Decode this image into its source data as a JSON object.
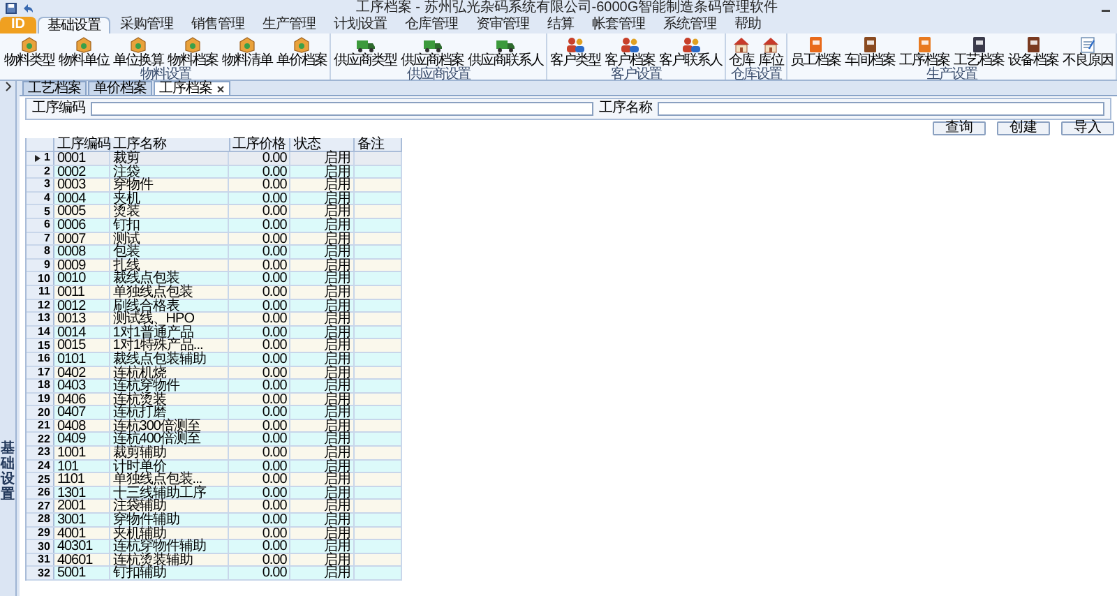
{
  "title_bar": {
    "title": "工序档案 - 苏州弘光杂码系统有限公司-6000G智能制造条码管理软件"
  },
  "menu": {
    "app_button": "ID",
    "tabs": [
      {
        "label": "基础设置",
        "selected": true
      },
      {
        "label": "采购管理",
        "selected": false
      },
      {
        "label": "销售管理",
        "selected": false
      },
      {
        "label": "生产管理",
        "selected": false
      },
      {
        "label": "计划设置",
        "selected": false
      },
      {
        "label": "仓库管理",
        "selected": false
      },
      {
        "label": "资审管理",
        "selected": false
      },
      {
        "label": "结算",
        "selected": false
      },
      {
        "label": "帐套管理",
        "selected": false
      },
      {
        "label": "系统管理",
        "selected": false
      },
      {
        "label": "帮助",
        "selected": false
      }
    ]
  },
  "ribbon": {
    "groups": [
      {
        "label": "物料设置",
        "items": [
          "物料类型",
          "物料单位",
          "单位换算",
          "物料档案",
          "物料清单",
          "单价档案"
        ]
      },
      {
        "label": "供应商设置",
        "items": [
          "供应商类型",
          "供应商档案",
          "供应商联系人"
        ]
      },
      {
        "label": "客户设置",
        "items": [
          "客户类型",
          "客户档案",
          "客户联系人"
        ]
      },
      {
        "label": "仓库设置",
        "items": [
          "仓库",
          "库位"
        ]
      },
      {
        "label": "生产设置",
        "items": [
          "员工档案",
          "车间档案",
          "工序档案",
          "工艺档案",
          "设备档案",
          "不良原因"
        ]
      }
    ]
  },
  "sidebar": {
    "label": "基础设置"
  },
  "doc_tabs": [
    {
      "label": "工艺档案",
      "selected": false
    },
    {
      "label": "单价档案",
      "selected": false
    },
    {
      "label": "工序档案",
      "selected": true
    }
  ],
  "search": {
    "fields": [
      {
        "label": "工序编码"
      },
      {
        "label": "工序名称"
      }
    ]
  },
  "buttons": [
    "查询",
    "创建",
    "导入"
  ],
  "table": {
    "columns": [
      "工序编码",
      "工序名称",
      "工序价格",
      "状态",
      "备注"
    ],
    "rows": [
      {
        "number": "1",
        "cells": [
          "0001",
          "裁剪",
          "0.00",
          "启用",
          ""
        ],
        "selected": true
      },
      {
        "number": "2",
        "cells": [
          "0002",
          "注袋",
          "0.00",
          "启用",
          ""
        ],
        "selected": false
      },
      {
        "number": "3",
        "cells": [
          "0003",
          "穿物件",
          "0.00",
          "启用",
          ""
        ],
        "selected": false
      },
      {
        "number": "4",
        "cells": [
          "0004",
          "夹机",
          "0.00",
          "启用",
          ""
        ],
        "selected": false
      },
      {
        "number": "5",
        "cells": [
          "0005",
          "烫装",
          "0.00",
          "启用",
          ""
        ],
        "selected": false
      },
      {
        "number": "6",
        "cells": [
          "0006",
          "钉扣",
          "0.00",
          "启用",
          ""
        ],
        "selected": false
      },
      {
        "number": "7",
        "cells": [
          "0007",
          "测试",
          "0.00",
          "启用",
          ""
        ],
        "selected": false
      },
      {
        "number": "8",
        "cells": [
          "0008",
          "包装",
          "0.00",
          "启用",
          ""
        ],
        "selected": false
      },
      {
        "number": "9",
        "cells": [
          "0009",
          "扎线",
          "0.00",
          "启用",
          ""
        ],
        "selected": false
      },
      {
        "number": "10",
        "cells": [
          "0010",
          "裁线点包装",
          "0.00",
          "启用",
          ""
        ],
        "selected": false
      },
      {
        "number": "11",
        "cells": [
          "0011",
          "单独线点包装",
          "0.00",
          "启用",
          ""
        ],
        "selected": false
      },
      {
        "number": "12",
        "cells": [
          "0012",
          "刷线合格表",
          "0.00",
          "启用",
          ""
        ],
        "selected": false
      },
      {
        "number": "13",
        "cells": [
          "0013",
          "测试线、HPO",
          "0.00",
          "启用",
          ""
        ],
        "selected": false
      },
      {
        "number": "14",
        "cells": [
          "0014",
          "1对1普通产品",
          "0.00",
          "启用",
          ""
        ],
        "selected": false
      },
      {
        "number": "15",
        "cells": [
          "0015",
          "1对1特殊产品...",
          "0.00",
          "启用",
          ""
        ],
        "selected": false
      },
      {
        "number": "16",
        "cells": [
          "0101",
          "裁线点包装辅助",
          "0.00",
          "启用",
          ""
        ],
        "selected": false
      },
      {
        "number": "17",
        "cells": [
          "0402",
          "连杭机烧",
          "0.00",
          "启用",
          ""
        ],
        "selected": false
      },
      {
        "number": "18",
        "cells": [
          "0403",
          "连杭穿物件",
          "0.00",
          "启用",
          ""
        ],
        "selected": false
      },
      {
        "number": "19",
        "cells": [
          "0406",
          "连杭烫装",
          "0.00",
          "启用",
          ""
        ],
        "selected": false
      },
      {
        "number": "20",
        "cells": [
          "0407",
          "连杭打磨",
          "0.00",
          "启用",
          ""
        ],
        "selected": false
      },
      {
        "number": "21",
        "cells": [
          "0408",
          "连杭300倍测至",
          "0.00",
          "启用",
          ""
        ],
        "selected": false
      },
      {
        "number": "22",
        "cells": [
          "0409",
          "连杭400倍测至",
          "0.00",
          "启用",
          ""
        ],
        "selected": false
      },
      {
        "number": "23",
        "cells": [
          "1001",
          "裁剪辅助",
          "0.00",
          "启用",
          ""
        ],
        "selected": false
      },
      {
        "number": "24",
        "cells": [
          "101",
          "计时单价",
          "0.00",
          "启用",
          ""
        ],
        "selected": false
      },
      {
        "number": "25",
        "cells": [
          "1101",
          "单独线点包装...",
          "0.00",
          "启用",
          ""
        ],
        "selected": false
      },
      {
        "number": "26",
        "cells": [
          "1301",
          "十三线辅助工序",
          "0.00",
          "启用",
          ""
        ],
        "selected": false
      },
      {
        "number": "27",
        "cells": [
          "2001",
          "注袋辅助",
          "0.00",
          "启用",
          ""
        ],
        "selected": false
      },
      {
        "number": "28",
        "cells": [
          "3001",
          "穿物件辅助",
          "0.00",
          "启用",
          ""
        ],
        "selected": false
      },
      {
        "number": "29",
        "cells": [
          "4001",
          "夹机辅助",
          "0.00",
          "启用",
          ""
        ],
        "selected": false
      },
      {
        "number": "30",
        "cells": [
          "40301",
          "连杭穿物件辅助",
          "0.00",
          "启用",
          ""
        ],
        "selected": false
      },
      {
        "number": "31",
        "cells": [
          "40601",
          "连杭烫装辅助",
          "0.00",
          "启用",
          ""
        ],
        "selected": false
      },
      {
        "number": "32",
        "cells": [
          "5001",
          "钉扣辅助",
          "0.00",
          "启用",
          ""
        ],
        "selected": false
      }
    ]
  }
}
